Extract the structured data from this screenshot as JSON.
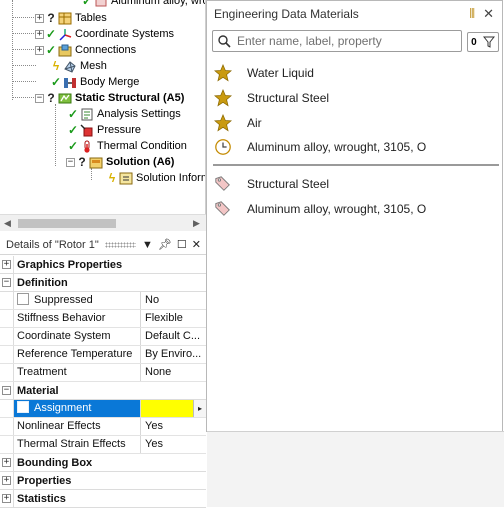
{
  "tree": {
    "items": [
      {
        "label": "Aluminum alloy, wro",
        "status": "check"
      },
      {
        "label": "Tables",
        "status": "question"
      },
      {
        "label": "Coordinate Systems",
        "status": "check"
      },
      {
        "label": "Connections",
        "status": "check"
      },
      {
        "label": "Mesh",
        "status": "lightning"
      },
      {
        "label": "Body Merge",
        "status": "check"
      },
      {
        "label": "Static Structural (A5)",
        "status": "question"
      },
      {
        "label": "Analysis Settings",
        "status": "check"
      },
      {
        "label": "Pressure",
        "status": "check"
      },
      {
        "label": "Thermal Condition",
        "status": "check"
      },
      {
        "label": "Solution (A6)",
        "status": "question"
      },
      {
        "label": "Solution Inform",
        "status": "lightning"
      }
    ]
  },
  "details": {
    "title": "Details of \"Rotor 1\"",
    "icons": [
      "dropdown-icon",
      "pin-icon",
      "maximize-icon",
      "close-icon"
    ],
    "rows": [
      {
        "type": "category",
        "expander": "+",
        "label": "Graphics Properties"
      },
      {
        "type": "category",
        "expander": "−",
        "label": "Definition"
      },
      {
        "type": "prop",
        "name": "Suppressed",
        "value": "No",
        "checkbox": true
      },
      {
        "type": "prop",
        "name": "Stiffness Behavior",
        "value": "Flexible"
      },
      {
        "type": "prop",
        "name": "Coordinate System",
        "value": "Default C..."
      },
      {
        "type": "prop",
        "name": "Reference Temperature",
        "value": "By Enviro..."
      },
      {
        "type": "prop",
        "name": "Treatment",
        "value": "None"
      },
      {
        "type": "category",
        "expander": "−",
        "label": "Material"
      },
      {
        "type": "prop",
        "name": "Assignment",
        "value": "",
        "checkbox": true,
        "selected": true
      },
      {
        "type": "prop",
        "name": "Nonlinear Effects",
        "value": "Yes"
      },
      {
        "type": "prop",
        "name": "Thermal Strain Effects",
        "value": "Yes"
      },
      {
        "type": "category",
        "expander": "+",
        "label": "Bounding Box"
      },
      {
        "type": "category",
        "expander": "+",
        "label": "Properties"
      },
      {
        "type": "category",
        "expander": "+",
        "label": "Statistics"
      }
    ]
  },
  "edm": {
    "title": "Engineering Data Materials",
    "search_placeholder": "Enter name, label, property",
    "filter_count": "0",
    "favorites": [
      {
        "label": "Water Liquid",
        "icon": "star-icon"
      },
      {
        "label": "Structural Steel",
        "icon": "star-icon"
      },
      {
        "label": "Air",
        "icon": "star-icon"
      },
      {
        "label": "Aluminum alloy, wrought, 3105, O",
        "icon": "clock-icon"
      }
    ],
    "tagged": [
      {
        "label": "Structural Steel",
        "icon": "tag-icon"
      },
      {
        "label": "Aluminum alloy, wrought, 3105, O",
        "icon": "tag-icon"
      }
    ]
  },
  "colors": {
    "selection_blue": "#0a78d7",
    "assignment_yellow": "#ffff00",
    "star_gold": "#c99a10",
    "check_green": "#1a9a1a"
  }
}
